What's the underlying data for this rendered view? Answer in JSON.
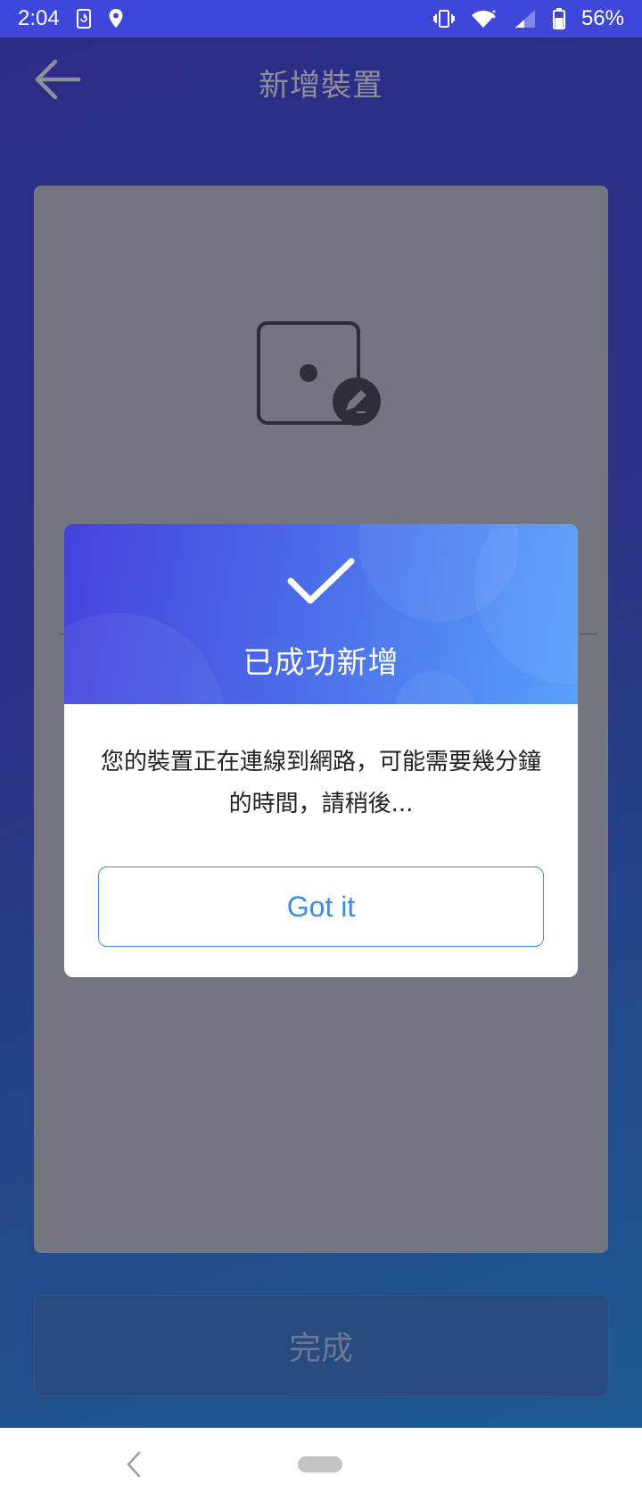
{
  "status_bar": {
    "time": "2:04",
    "battery_percent": "56%",
    "icons": [
      "sync-icon",
      "location-icon",
      "vibrate-icon",
      "wifi-icon",
      "signal-icon",
      "battery-icon"
    ]
  },
  "app_bar": {
    "title": "新增裝置",
    "back_icon": "arrow-left-icon"
  },
  "card": {
    "illustration": "device-edit-icon"
  },
  "footer": {
    "done_label": "完成"
  },
  "dialog": {
    "title": "已成功新增",
    "message": "您的裝置正在連線到網路，可能需要幾分鐘的時間，請稍後...",
    "message_line1": "您的裝置正在連線到網路，可能需要幾分鐘",
    "message_line2": "的時間，請稍後...",
    "button_label": "Got it",
    "icon": "checkmark-icon"
  },
  "colors": {
    "status_bar": "#3f47da",
    "dialog_header_start": "#4542dd",
    "dialog_header_end": "#56a0fb",
    "button_accent": "#3d8de2"
  }
}
